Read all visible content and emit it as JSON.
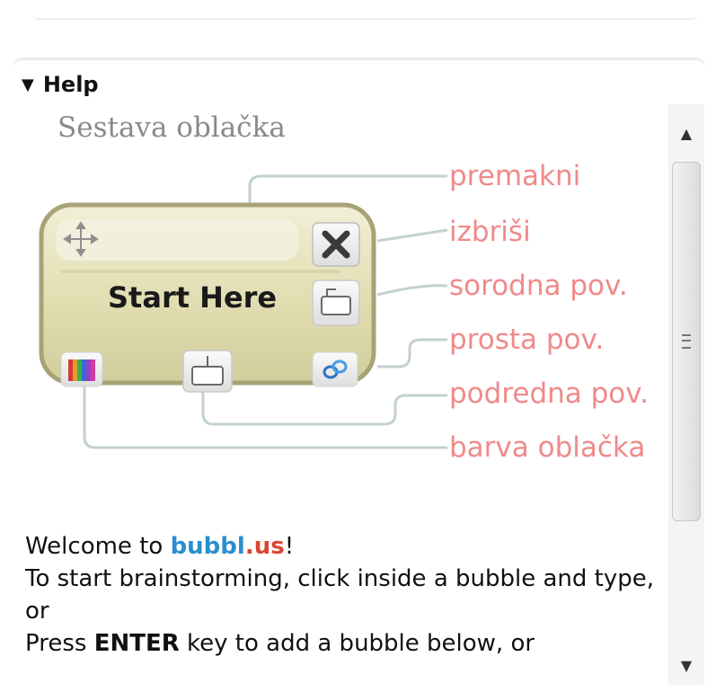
{
  "help": {
    "title": "Help",
    "subtitle": "Sestava oblačka"
  },
  "bubble": {
    "label": "Start Here"
  },
  "callouts": [
    {
      "label": "premakni"
    },
    {
      "label": "izbriši"
    },
    {
      "label": "sorodna pov."
    },
    {
      "label": "prosta pov."
    },
    {
      "label": "podredna pov."
    },
    {
      "label": "barva oblačka"
    }
  ],
  "welcome": {
    "line1_prefix": "Welcome to ",
    "brand_part1": "bubbl",
    "brand_part2": ".us",
    "line1_suffix": "!",
    "line2": "To start brainstorming, click inside a bubble and type, or",
    "line3_prefix": "Press ",
    "line3_key": "ENTER",
    "line3_suffix": " key to add a bubble below, or"
  },
  "icons": {
    "collapse": "triangle-down-icon",
    "move": "move-arrows-icon",
    "delete": "close-icon",
    "sibling": "sibling-bubble-icon",
    "child": "child-bubble-icon",
    "link": "link-icon",
    "color": "color-palette-icon",
    "scroll_up": "scroll-up-icon",
    "scroll_down": "scroll-down-icon"
  },
  "colors": {
    "callout": "#f08a8a",
    "bubble_fill": "#e3dfb4",
    "bubble_border": "#a8a277",
    "connector": "#c3d2cf",
    "brand_blue": "#2a8fcf",
    "brand_red": "#d9462f"
  }
}
